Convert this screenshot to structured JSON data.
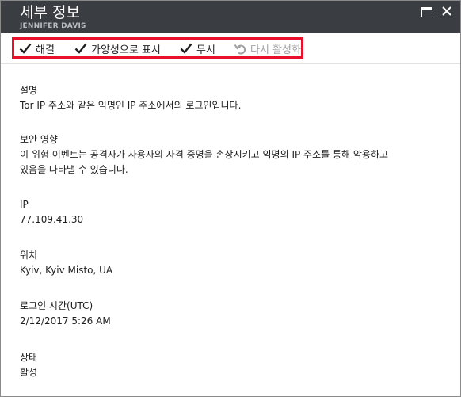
{
  "header": {
    "title": "세부 정보",
    "subtitle": "JENNIFER DAVIS",
    "maximize_icon": "maximize-icon",
    "close_icon": "close-icon",
    "background_color": "#3a3d42"
  },
  "toolbar": {
    "highlight_color": "#e8102a",
    "buttons": [
      {
        "label": "해결",
        "icon": "checkmark-icon",
        "enabled": true
      },
      {
        "label": "가양성으로 표시",
        "icon": "checkmark-icon",
        "enabled": true
      },
      {
        "label": "무시",
        "icon": "checkmark-icon",
        "enabled": true
      },
      {
        "label": "다시 활성화",
        "icon": "undo-icon",
        "enabled": false
      }
    ]
  },
  "details": {
    "description": {
      "label": "설명",
      "value": "Tor IP 주소와 같은 익명인 IP 주소에서의 로그인입니다."
    },
    "impact": {
      "label": "보안 영향",
      "value_line1": "이 위험 이벤트는 공격자가 사용자의 자격 증명을 손상시키고 익명의 IP 주소를 통해 악용하고",
      "value_line2": "있음을 나타낼 수 있습니다."
    },
    "ip": {
      "label": "IP",
      "value": "77.109.41.30"
    },
    "location": {
      "label": "위치",
      "value": "Kyiv, Kyiv Misto, UA"
    },
    "login_time": {
      "label": "로그인 시간(UTC)",
      "value": "2/12/2017 5:26 AM"
    },
    "status": {
      "label": "상태",
      "value": "활성"
    }
  }
}
